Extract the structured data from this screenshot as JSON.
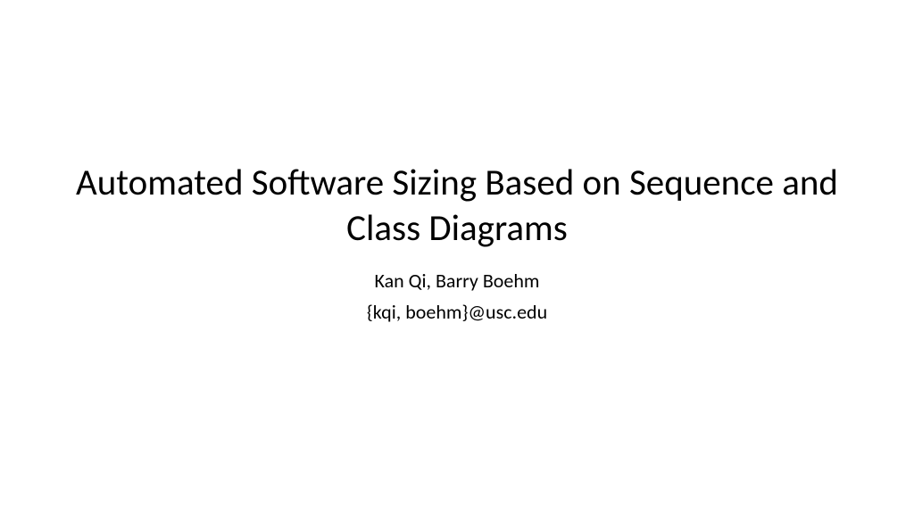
{
  "slide": {
    "title": "Automated Software Sizing Based on Sequence and Class Diagrams",
    "authors": "Kan Qi, Barry Boehm",
    "emails": "{kqi, boehm}@usc.edu"
  }
}
